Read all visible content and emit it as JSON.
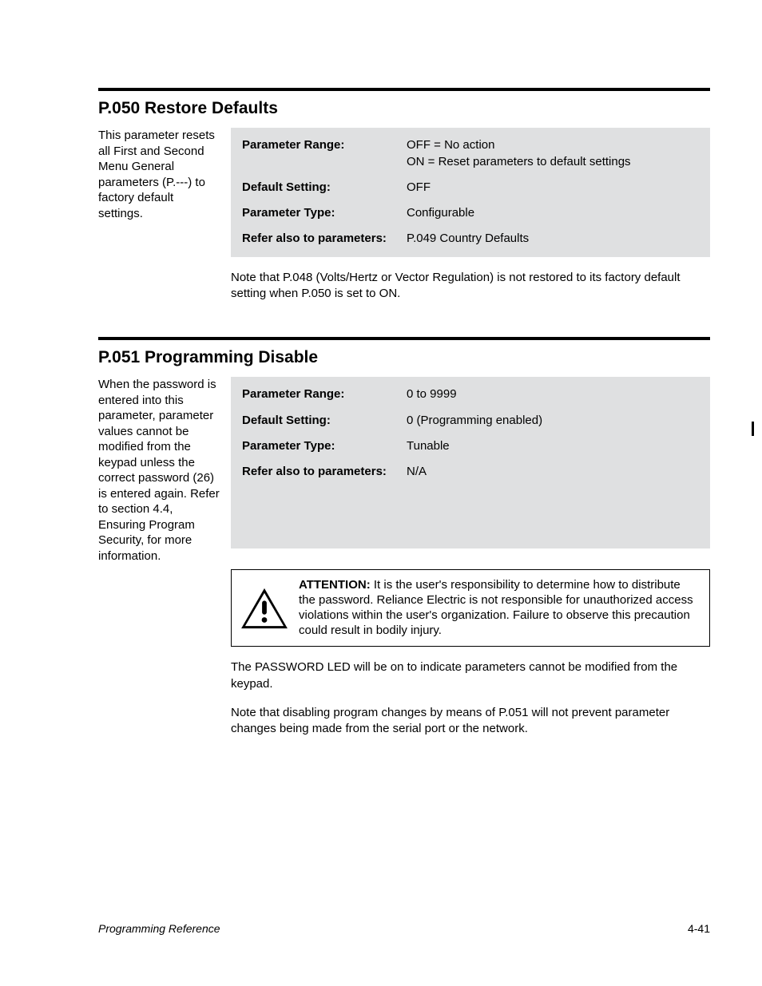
{
  "sections": [
    {
      "heading": "P.050 Restore Defaults",
      "sidenote": "This parameter resets all First and Second Menu General parameters (P.---) to factory default settings.",
      "rows": [
        {
          "label": "Parameter Range:",
          "value": "OFF = No action\nON = Reset parameters to default settings"
        },
        {
          "label": "Default Setting:",
          "value": "OFF"
        },
        {
          "label": "Parameter Type:",
          "value": "Configurable"
        },
        {
          "label": "Refer also to parameters:",
          "value": "P.049 Country Defaults"
        }
      ],
      "notes": [
        "Note that P.048 (Volts/Hertz or Vector Regulation) is not restored to its factory default setting when P.050 is set to ON."
      ]
    },
    {
      "heading": "P.051 Programming Disable",
      "sidenote": "When the password is entered into this parameter, parameter values cannot be modified from the keypad unless the correct password (26) is entered again. Refer to section 4.4, Ensuring Program Security, for more information.",
      "rows": [
        {
          "label": "Parameter Range:",
          "value": "0 to 9999"
        },
        {
          "label": "Default Setting:",
          "value": "0 (Programming enabled)"
        },
        {
          "label": "Parameter Type:",
          "value": "Tunable"
        },
        {
          "label": "Refer also to parameters:",
          "value": "N/A"
        }
      ],
      "attention": {
        "bold": "ATTENTION:",
        "text": " It is the user's responsibility to determine how to distribute the password. Reliance Electric is not responsible for unauthorized access violations within the user's organization. Failure to observe this precaution could result in bodily injury."
      },
      "notes": [
        "The PASSWORD LED will be on to indicate parameters cannot be modified from the keypad.",
        "Note that disabling program changes by means of P.051 will not prevent parameter changes being made from the serial port or the network."
      ]
    }
  ],
  "footer": {
    "left": "Programming Reference",
    "right": "4-41"
  }
}
